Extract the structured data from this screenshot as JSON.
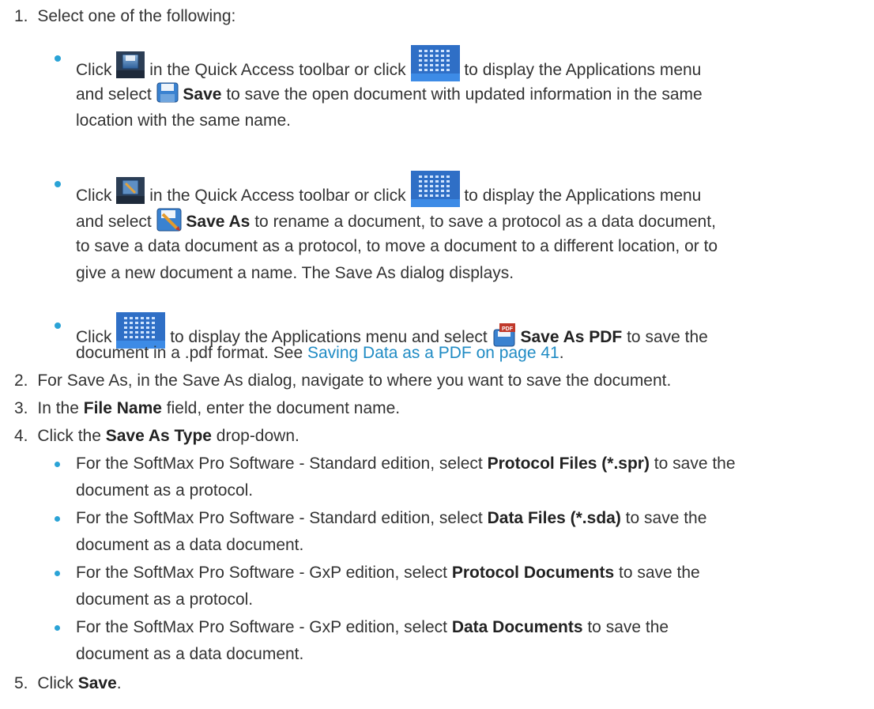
{
  "steps": {
    "s1": {
      "num": "1.",
      "text": "Select one of the following:"
    },
    "s2": {
      "num": "2.",
      "text": "For Save As, in the Save As dialog, navigate to where you want to save the document."
    },
    "s3": {
      "num": "3.",
      "pre": "In the ",
      "bold": "File Name",
      "post": " field, enter the document name."
    },
    "s4": {
      "num": "4.",
      "pre": "Click the ",
      "bold": "Save As Type",
      "post": " drop-down."
    },
    "s5": {
      "num": "5.",
      "pre": "Click ",
      "bold": "Save",
      "post": "."
    }
  },
  "b1": {
    "click": "Click",
    "mid": "in the Quick Access toolbar or click",
    "end": "to display the Applications menu",
    "and_select": "and select",
    "bold": "Save",
    "rest1": "to save the open document with updated information in the same",
    "rest2": "location with the same name."
  },
  "b2": {
    "click": "Click",
    "mid": "in the Quick Access toolbar or click",
    "end": "to display the Applications menu",
    "and_select": "and select",
    "bold": "Save As",
    "rest1": "to rename a document, to save a protocol as a data document,",
    "rest2": "to save a data document as a protocol, to move a document to a different location, or to",
    "rest3": "give a new document a name. The Save As dialog displays."
  },
  "b3": {
    "click": "Click",
    "mid": "to display the Applications menu and select",
    "bold": "Save As PDF",
    "rest1": "to save the",
    "rest2_pre": "document in a .pdf format. See ",
    "link": "Saving Data as a PDF on page 41",
    "rest2_post": "."
  },
  "sub": [
    {
      "pre": "For the SoftMax Pro Software - Standard edition, select ",
      "bold": "Protocol Files (*.spr)",
      "post": " to save the",
      "line2": "document as a protocol."
    },
    {
      "pre": "For the SoftMax Pro Software - Standard edition, select ",
      "bold": "Data Files (*.sda)",
      "post": " to save the",
      "line2": "document as a data document."
    },
    {
      "pre": "For the SoftMax Pro Software - GxP edition, select ",
      "bold": "Protocol Documents",
      "post": " to save the",
      "line2": "document as a protocol."
    },
    {
      "pre": "For the SoftMax Pro Software - GxP edition, select ",
      "bold": "Data Documents",
      "post": " to save the",
      "line2": "document as a data document."
    }
  ],
  "icons": {
    "save_toolbar": "floppy-save-icon",
    "save_as_toolbar": "save-as-icon",
    "app_menu": "applications-menu-icon",
    "save_pdf": "save-pdf-icon"
  },
  "colors": {
    "bullet": "#2aa3d6",
    "link": "#1f8bc4",
    "text": "#333333"
  }
}
